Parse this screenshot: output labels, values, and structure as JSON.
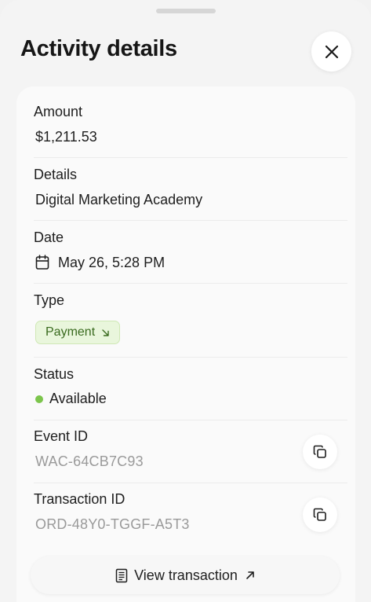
{
  "header": {
    "title": "Activity details"
  },
  "fields": {
    "amount_label": "Amount",
    "amount_value": "$1,211.53",
    "details_label": "Details",
    "details_value": "Digital Marketing Academy",
    "date_label": "Date",
    "date_value": "May 26, 5:28 PM",
    "type_label": "Type",
    "type_value": "Payment",
    "status_label": "Status",
    "status_value": "Available",
    "event_id_label": "Event ID",
    "event_id_value": "WAC-64CB7C93",
    "transaction_id_label": "Transaction ID",
    "transaction_id_value": "ORD-48Y0-TGGF-A5T3"
  },
  "actions": {
    "view_transaction_label": "View transaction"
  },
  "colors": {
    "status_available": "#7cc54c",
    "badge_bg": "#e9f6dc",
    "badge_text": "#3a6b1f"
  },
  "icons": {
    "close": "close-icon",
    "calendar": "calendar-icon",
    "incoming_arrow": "arrow-down-right-icon",
    "copy": "copy-icon",
    "receipt": "receipt-icon",
    "external": "arrow-up-right-icon"
  }
}
